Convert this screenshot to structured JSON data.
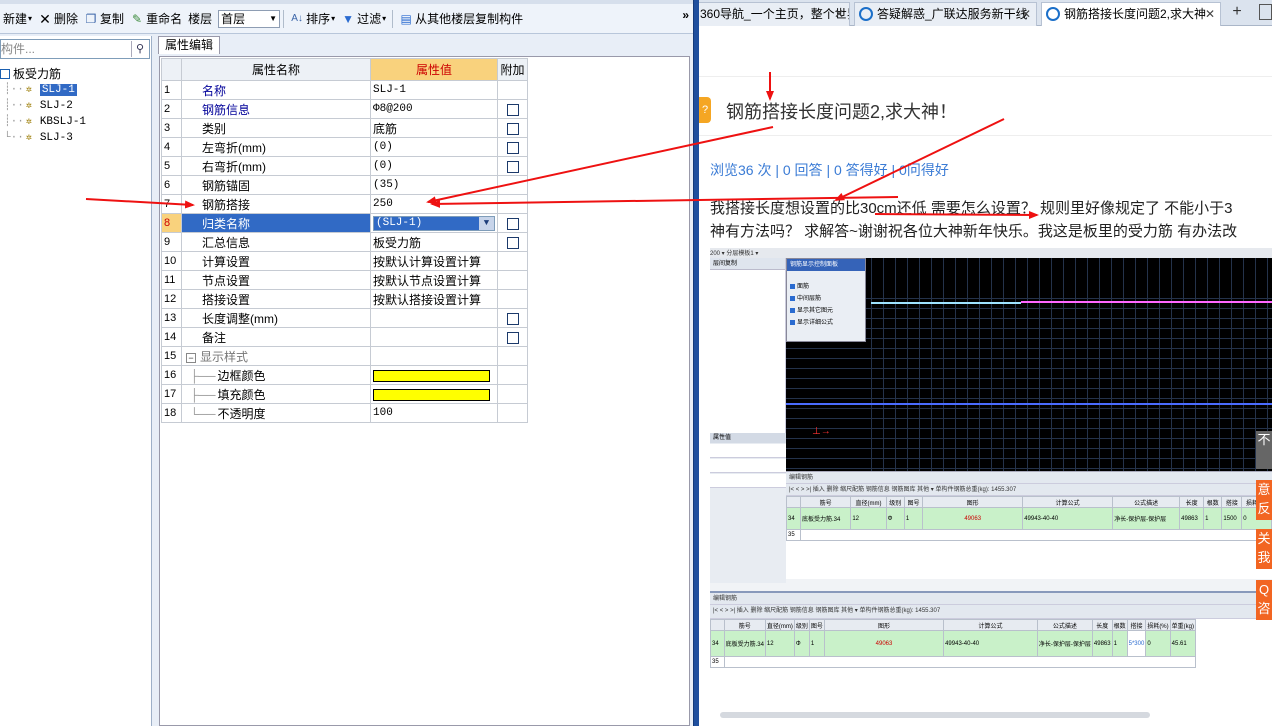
{
  "toolbar": {
    "new_label": "新建",
    "delete_label": "删除",
    "copy_label": "复制",
    "rename_label": "重命名",
    "floor_label": "楼层",
    "floor_value": "首层",
    "sort_label": "排序",
    "filter_label": "过滤",
    "copy_from_floor_label": "从其他楼层复制构件",
    "more_label": "»"
  },
  "tree": {
    "search_placeholder": "构件...",
    "root_label": "板受力筋",
    "items": [
      "SLJ-1",
      "SLJ-2",
      "KBSLJ-1",
      "SLJ-3"
    ],
    "selected_index": 0
  },
  "props": {
    "tab_label": "属性编辑",
    "col_name": "属性名称",
    "col_value": "属性值",
    "col_extra": "附加",
    "rows": [
      {
        "idx": "1",
        "name": "名称",
        "value": "SLJ-1"
      },
      {
        "idx": "2",
        "name": "钢筋信息",
        "value": "Φ8@200"
      },
      {
        "idx": "3",
        "name": "类别",
        "value": "底筋"
      },
      {
        "idx": "4",
        "name": "左弯折(mm)",
        "value": "(0)"
      },
      {
        "idx": "5",
        "name": "右弯折(mm)",
        "value": "(0)"
      },
      {
        "idx": "6",
        "name": "钢筋锚固",
        "value": "(35)"
      },
      {
        "idx": "7",
        "name": "钢筋搭接",
        "value": "250"
      },
      {
        "idx": "8",
        "name": "归类名称",
        "value": "(SLJ-1)"
      },
      {
        "idx": "9",
        "name": "汇总信息",
        "value": "板受力筋"
      },
      {
        "idx": "10",
        "name": "计算设置",
        "value": "按默认计算设置计算"
      },
      {
        "idx": "11",
        "name": "节点设置",
        "value": "按默认节点设置计算"
      },
      {
        "idx": "12",
        "name": "搭接设置",
        "value": "按默认搭接设置计算"
      },
      {
        "idx": "13",
        "name": "长度调整(mm)",
        "value": ""
      },
      {
        "idx": "14",
        "name": "备注",
        "value": ""
      },
      {
        "idx": "15",
        "name": "显示样式",
        "value": ""
      },
      {
        "idx": "16",
        "name": "边框颜色",
        "value": ""
      },
      {
        "idx": "17",
        "name": "填充颜色",
        "value": ""
      },
      {
        "idx": "18",
        "name": "不透明度",
        "value": "100"
      }
    ],
    "swatch_color": "#ffff00"
  },
  "browser": {
    "tabs": [
      {
        "title": "360导航_一个主页，整个世界"
      },
      {
        "title": "答疑解惑_广联达服务新干线"
      },
      {
        "title": "钢筋搭接长度问题2,求大神"
      }
    ],
    "new_tab": "+",
    "question": {
      "badge": "?",
      "title": "钢筋搭接长度问题2,求大神！",
      "stats": "浏览36 次 | 0 回答 | 0 答得好 | 0问得好",
      "body_line1": "我搭接长度想设置的比30cm还低 需要怎么设置？  规则里好像规定了 不能小于3",
      "body_line2": "神有方法吗？  求解答~谢谢祝各位大神新年快乐。我这是板里的受力筋 有办法改"
    },
    "side_buttons": [
      "不",
      "意",
      "反",
      "关",
      "我",
      "Q",
      "咨"
    ]
  },
  "shot": {
    "toolbar_text": "200 ▾  分层模板1 ▾",
    "left_bar": "层间复制",
    "dialog_title": "钢筋显示控制面板",
    "dialog_items": [
      "面筋",
      "中间层筋",
      "显示其它图元",
      "显示详细公式"
    ],
    "prop_bar": "属性值",
    "edit_bar": "编辑钢筋",
    "edit_toolbar": "|< < > >|  插入  删除  缩尺配筋  钢筋信息  钢筋图库  其他 ▾  单构件钢筋总重(kg): 1455.307",
    "headers": [
      "筋号",
      "直径(mm)",
      "级别",
      "图号",
      "图形",
      "计算公式",
      "公式描述",
      "长度",
      "根数",
      "搭接",
      "损耗(%)",
      "单重(kg)"
    ],
    "row_values": [
      "34",
      "底板受力筋.34",
      "12",
      "Φ",
      "1",
      "49063",
      "49943-40-40",
      "净长-保护层-保护层",
      "49863",
      "1",
      "1500",
      "0",
      "45.61"
    ],
    "row_values_bottom": [
      "34",
      "底板受力筋.34",
      "12",
      "Φ",
      "1",
      "49063",
      "49943-40-40",
      "净长-保护层-保护层",
      "49863",
      "1",
      "5*300",
      "0",
      "45.61"
    ],
    "empty_row": "35"
  },
  "colors": {
    "accent": "#316ac5",
    "header_highlight": "#f9d27d",
    "arrow": "#ee1111",
    "link": "#3a7bd5",
    "badge": "#f5a623"
  }
}
